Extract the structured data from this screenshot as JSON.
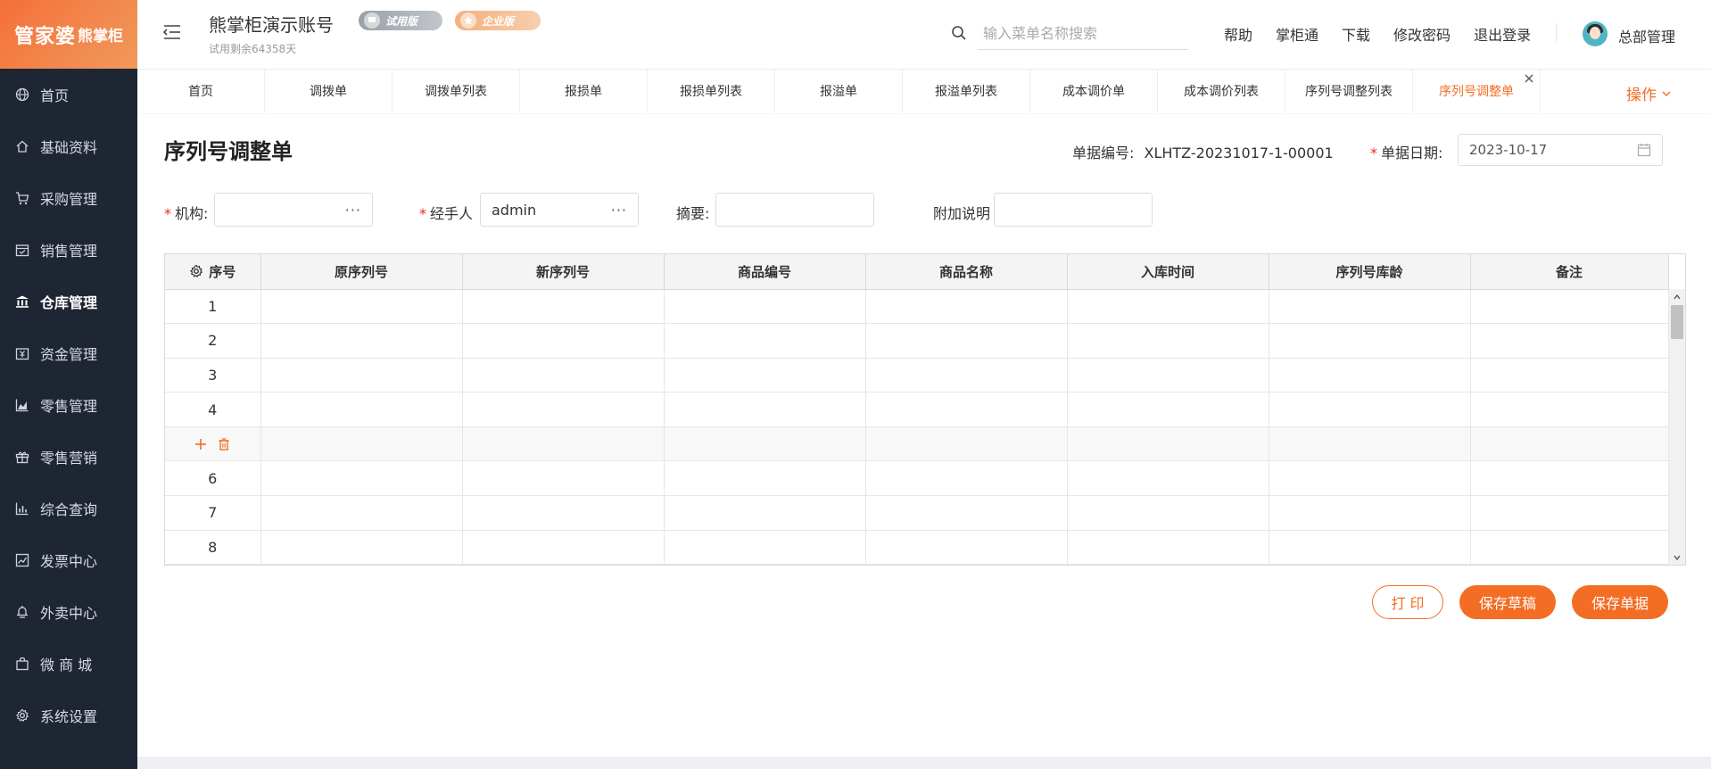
{
  "logo": {
    "part1": "管家婆",
    "part2": "熊掌柜"
  },
  "sidebar": {
    "items": [
      {
        "label": "首页",
        "icon": "globe-icon"
      },
      {
        "label": "基础资料",
        "icon": "home-icon"
      },
      {
        "label": "采购管理",
        "icon": "cart-icon"
      },
      {
        "label": "销售管理",
        "icon": "calendar-icon"
      },
      {
        "label": "仓库管理",
        "icon": "warehouse-icon"
      },
      {
        "label": "资金管理",
        "icon": "money-icon"
      },
      {
        "label": "零售管理",
        "icon": "area-chart-icon"
      },
      {
        "label": "零售营销",
        "icon": "gift-icon"
      },
      {
        "label": "综合查询",
        "icon": "bar-chart-icon"
      },
      {
        "label": "发票中心",
        "icon": "line-chart-icon"
      },
      {
        "label": "外卖中心",
        "icon": "bell-icon"
      },
      {
        "label": "微 商 城",
        "icon": "bag-icon"
      },
      {
        "label": "系统设置",
        "icon": "gear-icon"
      }
    ],
    "active_index": 4
  },
  "header": {
    "account_name": "熊掌柜演示账号",
    "trial_remaining": "试用剩余64358天",
    "badge_trial": "试用版",
    "badge_enterprise": "企业版",
    "search_placeholder": "输入菜单名称搜索",
    "links": [
      "帮助",
      "掌柜通",
      "下载",
      "修改密码",
      "退出登录"
    ],
    "user_name": "总部管理"
  },
  "tabs": {
    "items": [
      "首页",
      "调拨单",
      "调拨单列表",
      "报损单",
      "报损单列表",
      "报溢单",
      "报溢单列表",
      "成本调价单",
      "成本调价列表",
      "序列号调整列表",
      "序列号调整单"
    ],
    "active_index": 10,
    "operations_label": "操作"
  },
  "form": {
    "title": "序列号调整单",
    "doc_no_label": "单据编号:",
    "doc_no_value": "XLHTZ-20231017-1-00001",
    "date_label": "单据日期:",
    "date_value": "2023-10-17",
    "org_label": "机构:",
    "org_value": "",
    "handler_label": "经手人",
    "handler_value": "admin",
    "summary_label": "摘要:",
    "summary_value": "",
    "note_label": "附加说明",
    "note_value": ""
  },
  "table": {
    "columns": [
      "序号",
      "原序列号",
      "新序列号",
      "商品编号",
      "商品名称",
      "入库时间",
      "序列号库龄",
      "备注"
    ],
    "rows": [
      "1",
      "2",
      "3",
      "4",
      "",
      "6",
      "7",
      "8"
    ],
    "hover_row_index": 4
  },
  "buttons": {
    "print": "打 印",
    "save_draft": "保存草稿",
    "save_doc": "保存单据"
  },
  "colors": {
    "accent": "#f36d24",
    "sidebar_bg": "#1f2633",
    "required": "#f5222d"
  }
}
